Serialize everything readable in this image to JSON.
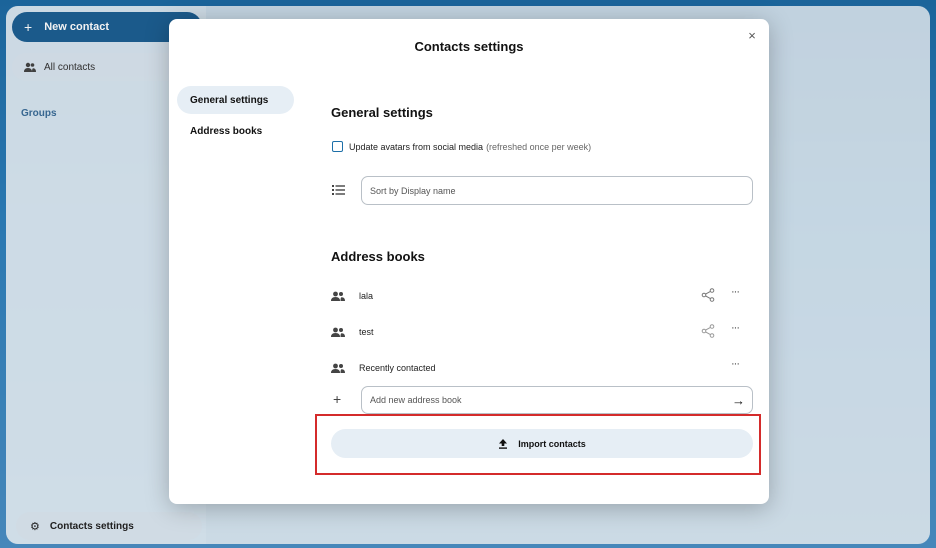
{
  "app": {
    "new_contact_label": "New contact",
    "all_contacts_label": "All contacts",
    "groups_label": "Groups",
    "contacts_settings_label": "Contacts settings"
  },
  "modal": {
    "title": "Contacts settings",
    "close_glyph": "×",
    "nav": [
      {
        "label": "General settings",
        "active": true
      },
      {
        "label": "Address books",
        "active": false
      }
    ],
    "general": {
      "heading": "General settings",
      "avatar_checkbox_label": "Update avatars from social media",
      "avatar_checkbox_hint": "(refreshed once per week)",
      "avatar_checked": false,
      "sort_value": "Sort by Display name"
    },
    "address_books": {
      "heading": "Address books",
      "items": [
        {
          "name": "lala",
          "shareable": true
        },
        {
          "name": "test",
          "shareable": true
        },
        {
          "name": "Recently contacted",
          "shareable": false
        }
      ],
      "add_placeholder": "Add new address book",
      "more_glyph": "···",
      "plus_glyph": "+",
      "arrow_glyph": "→"
    },
    "import_button_label": "Import contacts"
  },
  "colors": {
    "primary": "#1d5f93",
    "highlight": "#d42b2b",
    "active_nav_bg": "#e6eef5"
  }
}
